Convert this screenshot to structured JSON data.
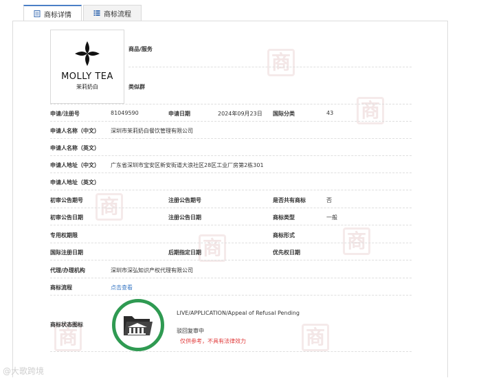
{
  "tabs": [
    {
      "label": "商标详情",
      "icon": "document-icon",
      "active": true
    },
    {
      "label": "商标流程",
      "icon": "list-icon",
      "active": false
    }
  ],
  "logo": {
    "brand": "MOLLY TEA",
    "brand_cn": "茉莉奶白"
  },
  "header_fields": {
    "goods_services_label": "商品/服务",
    "similar_group_label": "类似群"
  },
  "fields": {
    "reg_no_label": "申请/注册号",
    "reg_no": "81049590",
    "app_date_label": "申请日期",
    "app_date": "2024年09月23日",
    "intl_class_label": "国际分类",
    "intl_class": "43",
    "applicant_cn_label": "申请人名称（中文）",
    "applicant_cn": "深圳市茉莉奶白餐饮管理有限公司",
    "applicant_en_label": "申请人名称（英文）",
    "address_cn_label": "申请人地址（中文）",
    "address_cn": "广东省深圳市宝安区新安街道大浪社区28区工业厂房第2栋301",
    "address_en_label": "申请人地址（英文）",
    "prelim_no_label": "初审公告期号",
    "reg_pub_no_label": "注册公告期号",
    "shared_label": "是否共有商标",
    "shared": "否",
    "prelim_date_label": "初审公告日期",
    "reg_pub_date_label": "注册公告日期",
    "tm_type_label": "商标类型",
    "tm_type": "一般",
    "exclusive_label": "专用权期限",
    "tm_form_label": "商标形式",
    "intl_reg_date_label": "国际注册日期",
    "later_date_label": "后期指定日期",
    "priority_date_label": "优先权日期",
    "agent_label": "代理/办理机构",
    "agent": "深圳市深弘知识产权代理有限公司",
    "flow_label": "商标流程",
    "flow_link": "点击查看",
    "status_icon_label": "商标状态图标",
    "status_en": "LIVE/APPLICATION/Appeal of Refusal Pending",
    "status_cn": "驳回复审中"
  },
  "disclaimer": "仅供参考，不具有法律效力",
  "watermark_char": "商",
  "corner_watermark": "@大歌跨境",
  "colors": {
    "accent": "#4a7fc6",
    "prev_arrow": "#f08a24",
    "next_arrow": "#4a8fd6",
    "status_ring": "#2f9a52",
    "disclaimer": "#e03a3a"
  }
}
